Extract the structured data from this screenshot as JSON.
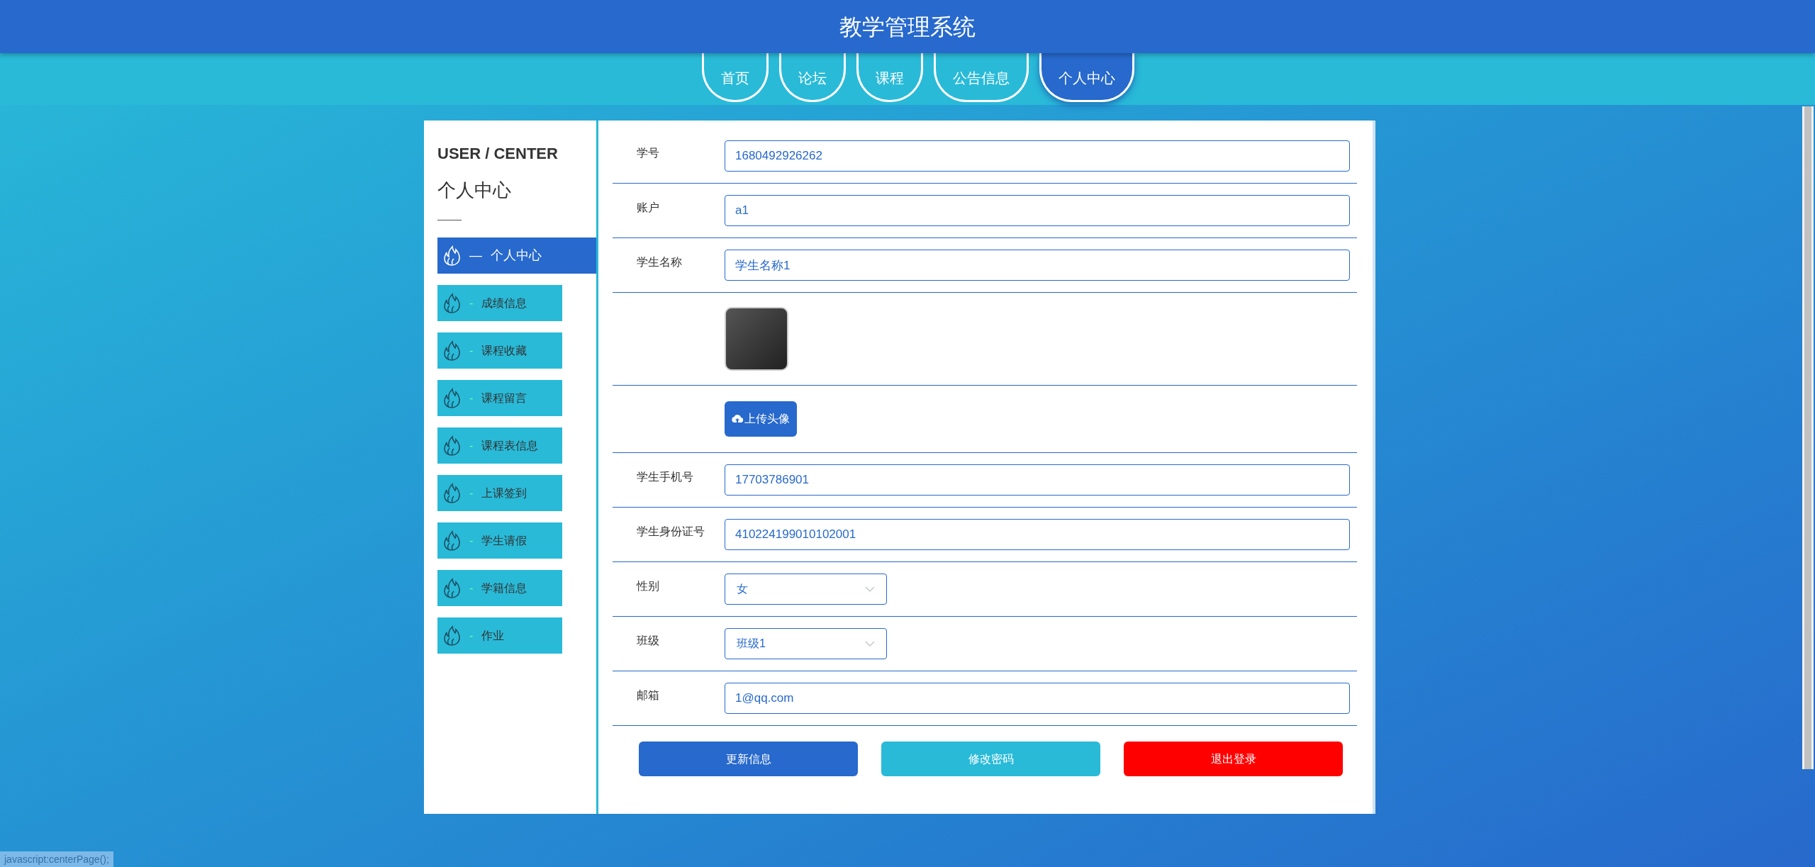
{
  "header": {
    "title": "教学管理系统"
  },
  "nav": [
    {
      "label": "首页",
      "selected": false
    },
    {
      "label": "论坛",
      "selected": false
    },
    {
      "label": "课程",
      "selected": false
    },
    {
      "label": "公告信息",
      "selected": false
    },
    {
      "label": "个人中心",
      "selected": true
    }
  ],
  "sidebar": {
    "eyebrow": "USER / CENTER",
    "title": "个人中心",
    "items": [
      {
        "dash": "—",
        "label": "个人中心",
        "selected": true
      },
      {
        "dash": "-",
        "label": "成绩信息",
        "selected": false
      },
      {
        "dash": "-",
        "label": "课程收藏",
        "selected": false
      },
      {
        "dash": "-",
        "label": "课程留言",
        "selected": false
      },
      {
        "dash": "-",
        "label": "课程表信息",
        "selected": false
      },
      {
        "dash": "-",
        "label": "上课签到",
        "selected": false
      },
      {
        "dash": "-",
        "label": "学生请假",
        "selected": false
      },
      {
        "dash": "-",
        "label": "学籍信息",
        "selected": false
      },
      {
        "dash": "-",
        "label": "作业",
        "selected": false
      }
    ]
  },
  "form": {
    "rows": [
      {
        "kind": "text",
        "label": "学号",
        "value": "1680492926262"
      },
      {
        "kind": "text",
        "label": "账户",
        "value": "a1"
      },
      {
        "kind": "text",
        "label": "学生名称",
        "value": "学生名称1"
      },
      {
        "kind": "image"
      },
      {
        "kind": "upload",
        "button": "上传头像"
      },
      {
        "kind": "text",
        "label": "学生手机号",
        "value": "17703786901"
      },
      {
        "kind": "text",
        "label": "学生身份证号",
        "value": "410224199010102001"
      },
      {
        "kind": "select",
        "label": "性别",
        "value": "女"
      },
      {
        "kind": "select",
        "label": "班级",
        "value": "班级1"
      },
      {
        "kind": "text",
        "label": "邮箱",
        "value": "1@qq.com"
      }
    ],
    "buttons": [
      {
        "label": "更新信息",
        "color": "#2769cc"
      },
      {
        "label": "修改密码",
        "color": "#29bad8"
      },
      {
        "label": "退出登录",
        "color": "#ff0000"
      }
    ]
  },
  "status_bar": {
    "text": "javascript:centerPage();"
  }
}
